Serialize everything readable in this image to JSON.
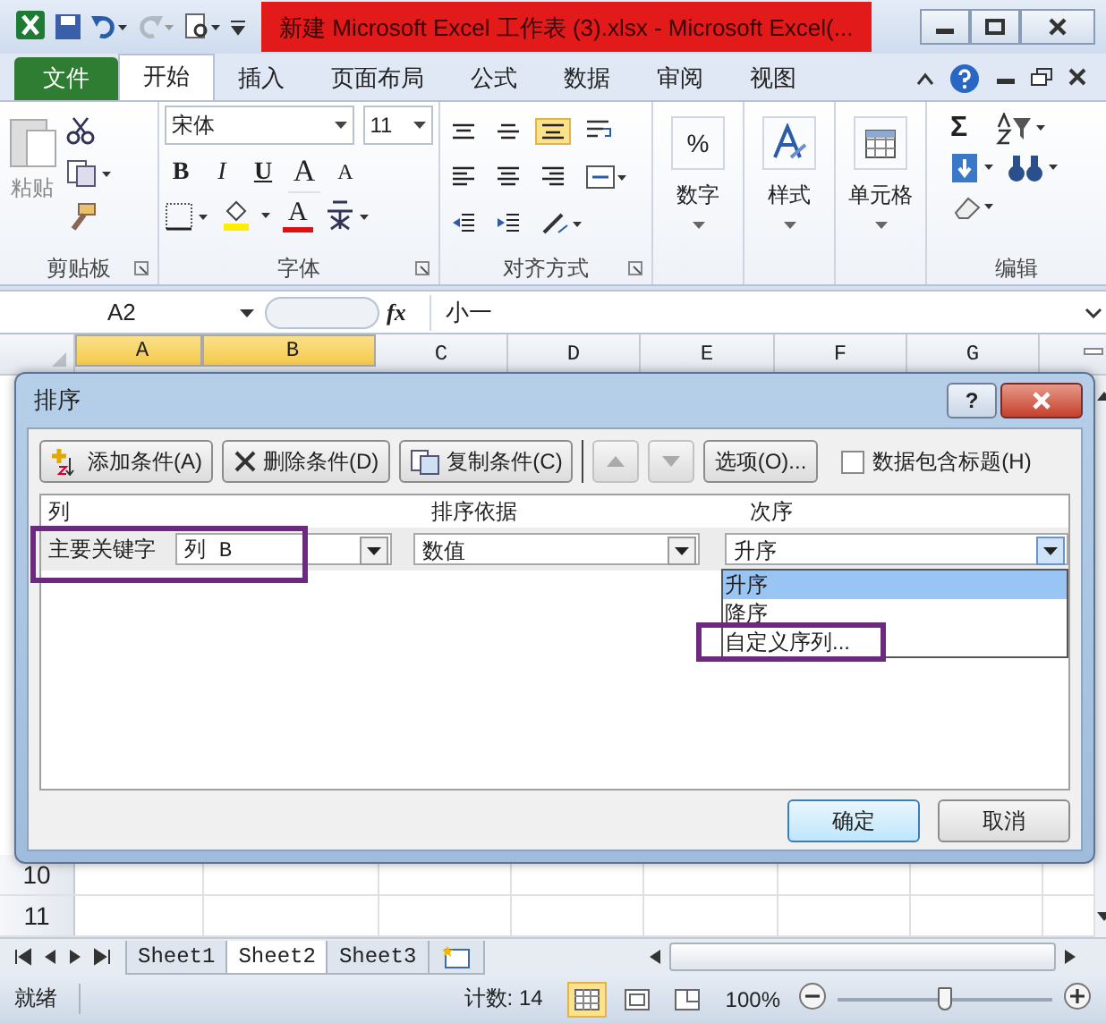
{
  "window": {
    "title": "新建 Microsoft Excel 工作表 (3).xlsx - Microsoft Excel(..."
  },
  "ribbon_tabs": [
    {
      "label": "文件",
      "kind": "file",
      "selected": false
    },
    {
      "label": "开始",
      "kind": "tab",
      "selected": true
    },
    {
      "label": "插入",
      "kind": "tab",
      "selected": false
    },
    {
      "label": "页面布局",
      "kind": "tab",
      "selected": false
    },
    {
      "label": "公式",
      "kind": "tab",
      "selected": false
    },
    {
      "label": "数据",
      "kind": "tab",
      "selected": false
    },
    {
      "label": "审阅",
      "kind": "tab",
      "selected": false
    },
    {
      "label": "视图",
      "kind": "tab",
      "selected": false
    }
  ],
  "clipboard": {
    "label": "剪贴板",
    "paste": "粘贴"
  },
  "font": {
    "label": "字体",
    "name": "宋体",
    "size": "11",
    "bold": "B",
    "italic": "I",
    "underline": "U",
    "grow": "A",
    "shrink": "A",
    "font_color": "A"
  },
  "alignment": {
    "label": "对齐方式",
    "vertical": [
      {
        "selected": false
      },
      {
        "selected": false
      },
      {
        "selected": true
      }
    ]
  },
  "number": {
    "label": "数字",
    "symbol": "%"
  },
  "styles": {
    "label": "样式"
  },
  "cells": {
    "label": "单元格"
  },
  "editing": {
    "label": "编辑",
    "sum": "Σ"
  },
  "formula_bar": {
    "name_box": "A2",
    "fx": "fx",
    "value": "小一"
  },
  "columns": [
    {
      "label": "A",
      "selected": true
    },
    {
      "label": "B",
      "selected": true
    },
    {
      "label": "C",
      "selected": false
    },
    {
      "label": "D",
      "selected": false
    },
    {
      "label": "E",
      "selected": false
    },
    {
      "label": "F",
      "selected": false
    },
    {
      "label": "G",
      "selected": false
    }
  ],
  "rows": [
    {
      "label": "10"
    },
    {
      "label": "11"
    }
  ],
  "dialog": {
    "title": "排序",
    "help": "?",
    "buttons": [
      {
        "label": "添加条件(A)",
        "kind": "add"
      },
      {
        "label": "删除条件(D)",
        "kind": "delete"
      },
      {
        "label": "复制条件(C)",
        "kind": "copy"
      }
    ],
    "options": "选项(O)...",
    "header_checkbox": {
      "label": "数据包含标题(H)",
      "checked": false
    },
    "headers": [
      "列",
      "排序依据",
      "次序"
    ],
    "level": {
      "label": "主要关键字",
      "column": "列 B",
      "sort_on": "数值",
      "order": "升序"
    },
    "order_options": [
      {
        "label": "升序",
        "selected": true
      },
      {
        "label": "降序",
        "selected": false
      },
      {
        "label": "自定义序列...",
        "selected": false
      }
    ],
    "ok": "确定",
    "cancel": "取消"
  },
  "sheets": [
    {
      "label": "Sheet1",
      "selected": false
    },
    {
      "label": "Sheet2",
      "selected": true
    },
    {
      "label": "Sheet3",
      "selected": false
    }
  ],
  "status_bar": {
    "ready": "就绪",
    "count": "计数: 14",
    "zoom": "100%",
    "zoom_slider": {
      "level": 0.5
    }
  }
}
